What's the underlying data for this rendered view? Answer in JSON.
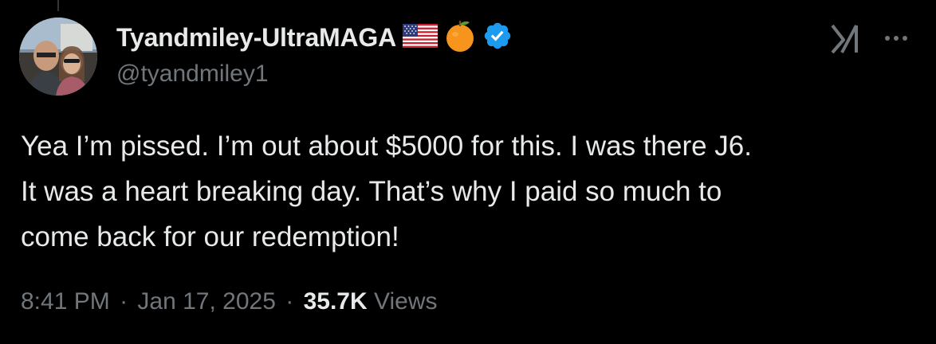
{
  "author": {
    "display_name": "Tyandmiley-UltraMAGA",
    "handle": "@tyandmiley1",
    "badges": [
      "us-flag-icon",
      "orange-emoji-icon",
      "verified-badge-icon"
    ]
  },
  "actions": {
    "grok_icon": "grok-icon",
    "more_icon": "more-options-icon"
  },
  "tweet": {
    "lines": [
      "Yea I’m pissed. I’m out about $5000 for this.  I was there J6.",
      "It was a heart breaking day. That’s why I paid so much to",
      "come back for our redemption!"
    ]
  },
  "meta": {
    "time": "8:41 PM",
    "separator": "·",
    "date": "Jan 17, 2025",
    "views_count": "35.7K",
    "views_label": "Views"
  },
  "colors": {
    "background": "#000000",
    "text_primary": "#e7e9ea",
    "text_secondary": "#71767b",
    "verified_blue": "#1d9bf0",
    "orange": "#f7941d"
  }
}
